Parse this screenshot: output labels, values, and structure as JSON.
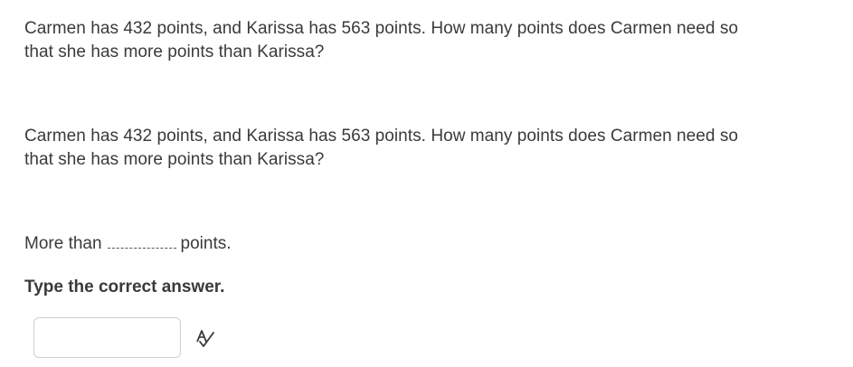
{
  "question": {
    "paragraph_1": "Carmen has 432 points, and Karissa has 563 points. How many points does Carmen need so that she has more points than Karissa?",
    "paragraph_2": "Carmen has 432 points, and Karissa has 563 points. How many points does Carmen need so that she has more points than Karissa?",
    "fill_prefix": "More than",
    "fill_suffix": "points."
  },
  "instruction": "Type the correct answer.",
  "answer": {
    "value": "",
    "placeholder": ""
  },
  "icons": {
    "spell_check": "spell-check-icon"
  }
}
